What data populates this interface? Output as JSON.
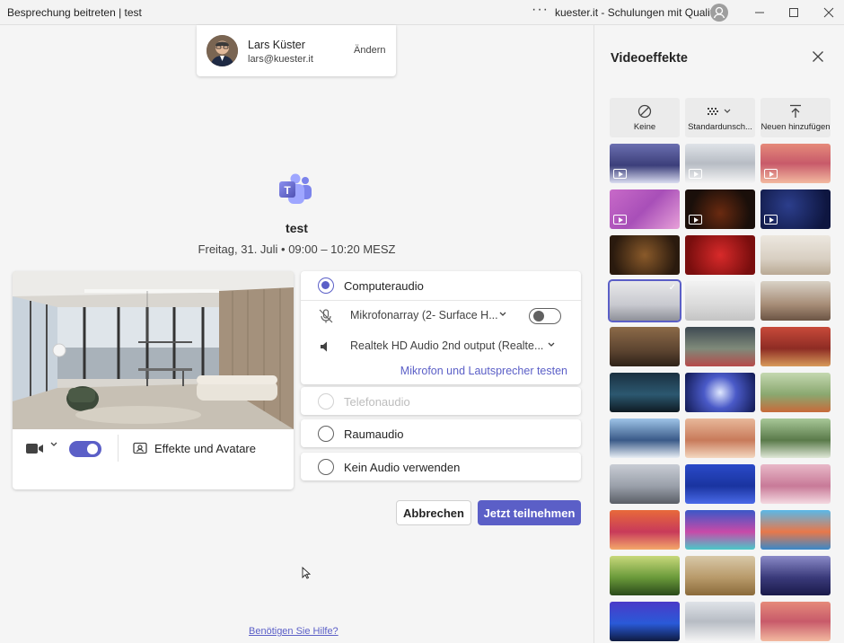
{
  "window": {
    "title": "Besprechung beitreten | test",
    "org": "kuester.it - Schulungen mit Qualität",
    "more_icon": "more-icon",
    "controls": [
      "minimize-icon",
      "maximize-icon",
      "close-icon"
    ]
  },
  "account": {
    "name": "Lars Küster",
    "email": "lars@kuester.it",
    "change_label": "Ändern"
  },
  "meeting": {
    "title": "test",
    "time": "Freitag, 31. Juli  •  09:00  –  10:20 MESZ"
  },
  "preview": {
    "camera_on": true,
    "effects_label": "Effekte und Avatare"
  },
  "audio": {
    "options": [
      {
        "label": "Computeraudio",
        "selected": true,
        "disabled": false
      },
      {
        "label": "Telefonaudio",
        "selected": false,
        "disabled": true
      },
      {
        "label": "Raumaudio",
        "selected": false,
        "disabled": false
      },
      {
        "label": "Kein Audio verwenden",
        "selected": false,
        "disabled": false
      }
    ],
    "microphone": "Mikrofonarray (2- Surface H...",
    "mic_on": false,
    "speaker": "Realtek HD Audio 2nd output (Realte...",
    "test_link": "Mikrofon und Lautsprecher testen"
  },
  "actions": {
    "cancel_label": "Abbrechen",
    "join_label": "Jetzt teilnehmen"
  },
  "help_link": "Benötigen Sie Hilfe?",
  "effects_panel": {
    "title": "Videoeffekte",
    "options": [
      {
        "label": "Keine",
        "icon": "none-icon"
      },
      {
        "label": "Standardunsch...",
        "icon": "blur-icon"
      },
      {
        "label": "Neuen hinzufügen",
        "icon": "upload-icon"
      }
    ],
    "selected_index": 9
  },
  "colors": {
    "accent": "#5b5fc7",
    "background": "#f5f5f5"
  }
}
